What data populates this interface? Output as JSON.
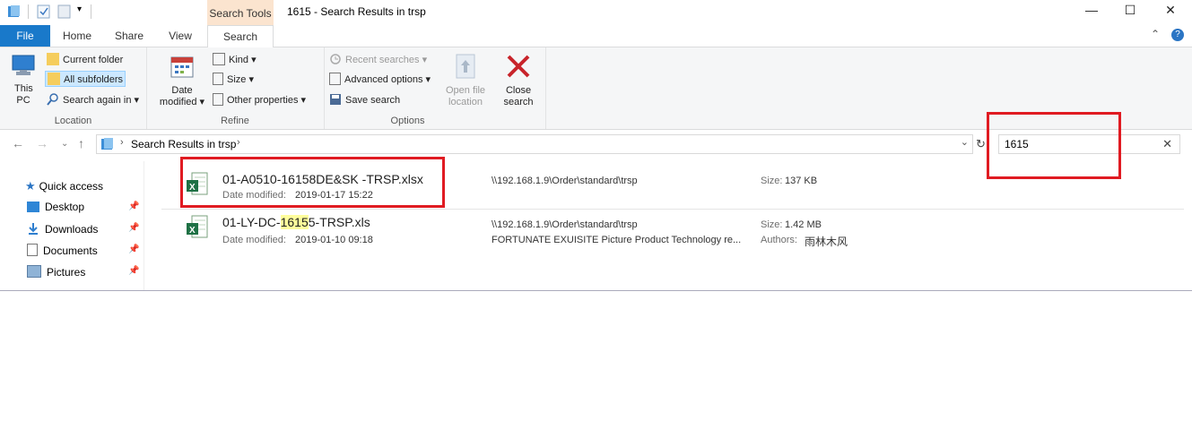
{
  "window": {
    "title": "1615 - Search Results in trsp",
    "context_tab": "Search Tools",
    "min": "—",
    "max": "☐",
    "close": "✕"
  },
  "tabs": [
    "File",
    "Home",
    "Share",
    "View",
    "Search"
  ],
  "ribbon": {
    "location": {
      "label": "Location",
      "this_pc": "This PC",
      "current_folder": "Current folder",
      "all_subfolders": "All subfolders",
      "search_again": "Search again in"
    },
    "refine": {
      "label": "Refine",
      "date_modified_line1": "Date",
      "date_modified_line2": "modified",
      "kind": "Kind",
      "size": "Size",
      "other": "Other properties"
    },
    "options": {
      "label": "Options",
      "recent": "Recent searches",
      "advanced": "Advanced options",
      "save": "Save search",
      "open_loc_1": "Open file",
      "open_loc_2": "location",
      "close_1": "Close",
      "close_2": "search"
    }
  },
  "address": {
    "path": "Search Results in trsp"
  },
  "search": {
    "value": "1615"
  },
  "nav": {
    "quick_access": "Quick access",
    "items": [
      "Desktop",
      "Downloads",
      "Documents",
      "Pictures"
    ]
  },
  "results": [
    {
      "name": "01-A0510-16158DE&SK -TRSP.xlsx",
      "date_label": "Date modified:",
      "date": "2019-01-17 15:22",
      "path": "\\\\192.168.1.9\\Order\\standard\\trsp",
      "size_label": "Size:",
      "size": "137 KB"
    },
    {
      "name_pre": "01-LY-DC-",
      "name_hl": "1615",
      "name_post": "5-TRSP.xls",
      "date_label": "Date modified:",
      "date": "2019-01-10 09:18",
      "path": "\\\\192.168.1.9\\Order\\standard\\trsp",
      "company": "FORTUNATE EXUISITE Picture Product Technology re...",
      "size_label": "Size:",
      "size": "1.42 MB",
      "authors_label": "Authors:",
      "authors": "雨林木风"
    }
  ],
  "colors": {
    "accent": "#1979ca",
    "context_tab": "#fbe4cf",
    "highlight": "#fffe9c",
    "annotation": "#e01b22"
  }
}
